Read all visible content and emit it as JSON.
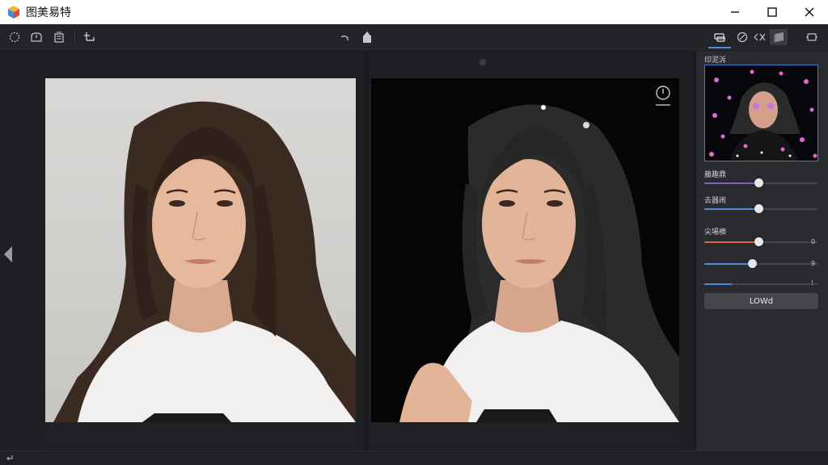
{
  "app": {
    "title": "图美易特",
    "icon": "app-cube-logo"
  },
  "window_controls": [
    "minimize-icon",
    "maximize-icon",
    "close-icon"
  ],
  "toolbar": {
    "left_tools": [
      "lasso-icon",
      "shape-icon",
      "layers-icon",
      "crop-plus-icon"
    ],
    "center_tools": [
      "undo-icon",
      "export-icon"
    ],
    "right_tools": [
      "cutout-mode-icon",
      "brush-icon",
      "eraser-icon",
      "background-icon",
      "rotate-icon"
    ],
    "active_tool": "cutout-mode-icon"
  },
  "canvas": {
    "left_nav": "triangle-left-icon",
    "compare_control": "compare-slider-icon",
    "original_image": "portrait of a young woman with long dark hair in a white T-shirt on a light grey background",
    "result_image": "the same portrait with background removed on a black background"
  },
  "panel": {
    "preview_label": "印泥泝",
    "sliders": [
      {
        "label": "藤趣鼎",
        "value": 0.48,
        "color": "#8a5cc4",
        "value_text": ""
      },
      {
        "label": "去器闹",
        "value": 0.48,
        "color": "#4c8bd6",
        "value_text": ""
      },
      {
        "label": "尖場襖",
        "value": 0.48,
        "color": "#e2643a",
        "value_text": "0"
      },
      {
        "label": "",
        "value": 0.42,
        "color": "#4c8bd6",
        "value_text": "9"
      },
      {
        "label": "",
        "value": 0.24,
        "color": "#4c8bd6",
        "value_text": "!"
      }
    ],
    "apply_label": "LOWd"
  },
  "colors": {
    "accent": "#4a8fd8",
    "panel_bg": "#2a2b2e",
    "canvas_bg": "#1e1f22"
  }
}
